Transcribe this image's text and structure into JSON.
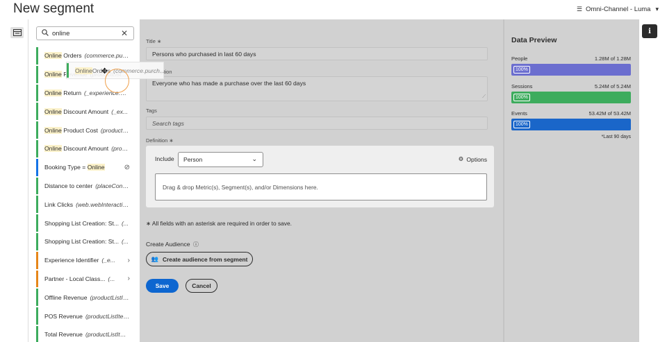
{
  "header": {
    "title": "New segment",
    "report_suite": "Omni-Channel - Luma"
  },
  "search": {
    "value": "online",
    "placeholder": ""
  },
  "components": [
    {
      "pre": "",
      "hl": "Online",
      "post": " Orders",
      "id": "(commerce.purc...",
      "color": "green",
      "trail": ""
    },
    {
      "pre": "",
      "hl": "Online",
      "post": " Revenue",
      "id": "(productList...",
      "color": "green",
      "trail": ""
    },
    {
      "pre": "",
      "hl": "Online",
      "post": " Return",
      "id": "(_experience.an...",
      "color": "green",
      "trail": ""
    },
    {
      "pre": "",
      "hl": "Online",
      "post": " Discount Amount",
      "id": "(_ex...",
      "color": "green",
      "trail": ""
    },
    {
      "pre": "",
      "hl": "Online",
      "post": " Product Cost",
      "id": "(productLi...",
      "color": "green",
      "trail": ""
    },
    {
      "pre": "",
      "hl": "Online",
      "post": " Discount Amount",
      "id": "(prod...",
      "color": "green",
      "trail": ""
    },
    {
      "pre": "Booking Type = ",
      "hl": "Online",
      "post": "",
      "id": "",
      "color": "blue",
      "trail": "⊘"
    },
    {
      "pre": "Distance to center",
      "hl": "",
      "post": "",
      "id": "(placeConte...",
      "color": "green",
      "trail": ""
    },
    {
      "pre": "Link Clicks",
      "hl": "",
      "post": "",
      "id": "(web.webInteraction...",
      "color": "green",
      "trail": ""
    },
    {
      "pre": "Shopping List Creation: St...",
      "hl": "",
      "post": "",
      "id": "(...",
      "color": "green",
      "trail": ""
    },
    {
      "pre": "Shopping List Creation: St...",
      "hl": "",
      "post": "",
      "id": "(...",
      "color": "green",
      "trail": ""
    },
    {
      "pre": "Experience Identifier",
      "hl": "",
      "post": "",
      "id": "(_e...",
      "color": "orange",
      "trail": "›"
    },
    {
      "pre": "Partner - Local Class...",
      "hl": "",
      "post": "",
      "id": "(...",
      "color": "orange",
      "trail": "›"
    },
    {
      "pre": "Offline Revenue",
      "hl": "",
      "post": "",
      "id": "(productListIte...",
      "color": "green",
      "trail": ""
    },
    {
      "pre": "POS Revenue",
      "hl": "",
      "post": "",
      "id": "(productListItem...",
      "color": "green",
      "trail": ""
    },
    {
      "pre": "Total Revenue",
      "hl": "",
      "post": "",
      "id": "(productListItem...",
      "color": "green",
      "trail": ""
    }
  ],
  "drag_ghost": {
    "hl": "Online",
    "post": " Orders",
    "id": "(commerce.purch..."
  },
  "form": {
    "title_label": "Title ∗",
    "title_value": "Persons who purchased in last 60 days",
    "description_label": "Description",
    "description_value": "Everyone who has made a purchase over the last 60 days",
    "tags_label": "Tags",
    "tags_placeholder": "Search tags",
    "definition_label": "Definition ∗",
    "include_label": "Include",
    "include_value": "Person",
    "options_label": "Options",
    "dropzone_text": "Drag & drop Metric(s), Segment(s), and/or Dimensions here.",
    "required_note": "∗ All fields with an asterisk are required in order to save.",
    "audience_label": "Create Audience",
    "audience_button": "Create audience from segment",
    "save_button": "Save",
    "cancel_button": "Cancel"
  },
  "preview": {
    "title": "Data Preview",
    "metrics": [
      {
        "name": "People",
        "value": "1.28M of 1.28M",
        "pct": "100%",
        "color": "#6b6ecf"
      },
      {
        "name": "Sessions",
        "value": "5.24M of 5.24M",
        "pct": "100%",
        "color": "#3dac5d"
      },
      {
        "name": "Events",
        "value": "53.42M of 53.42M",
        "pct": "100%",
        "color": "#1a66c9"
      }
    ],
    "footnote": "*Last 90 days"
  },
  "colors": {
    "green": "#3dac5d",
    "blue": "#1473e6",
    "orange": "#e68619",
    "primary": "#0d66d0"
  }
}
